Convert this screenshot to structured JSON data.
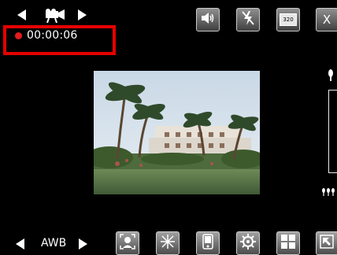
{
  "recording": {
    "timecode": "00:00:06"
  },
  "mode_selector": {
    "icon": "video-camera-icon"
  },
  "toolbar_top": {
    "sound": {
      "icon": "speaker-icon"
    },
    "flash": {
      "icon": "flash-off-icon"
    },
    "resolution": {
      "label": "320"
    },
    "close": {
      "label": "X"
    }
  },
  "white_balance": {
    "label": "AWB"
  },
  "toolbar_bottom": [
    {
      "name": "face-detect-button",
      "icon": "face-detect-icon"
    },
    {
      "name": "effects-button",
      "icon": "sparkle-icon"
    },
    {
      "name": "device-button",
      "icon": "device-icon"
    },
    {
      "name": "settings-button",
      "icon": "gear-icon"
    },
    {
      "name": "grid-button",
      "icon": "grid-icon"
    },
    {
      "name": "collapse-button",
      "icon": "arrow-up-left-icon"
    }
  ],
  "colors": {
    "record_red": "#e60000",
    "background": "#000000"
  }
}
